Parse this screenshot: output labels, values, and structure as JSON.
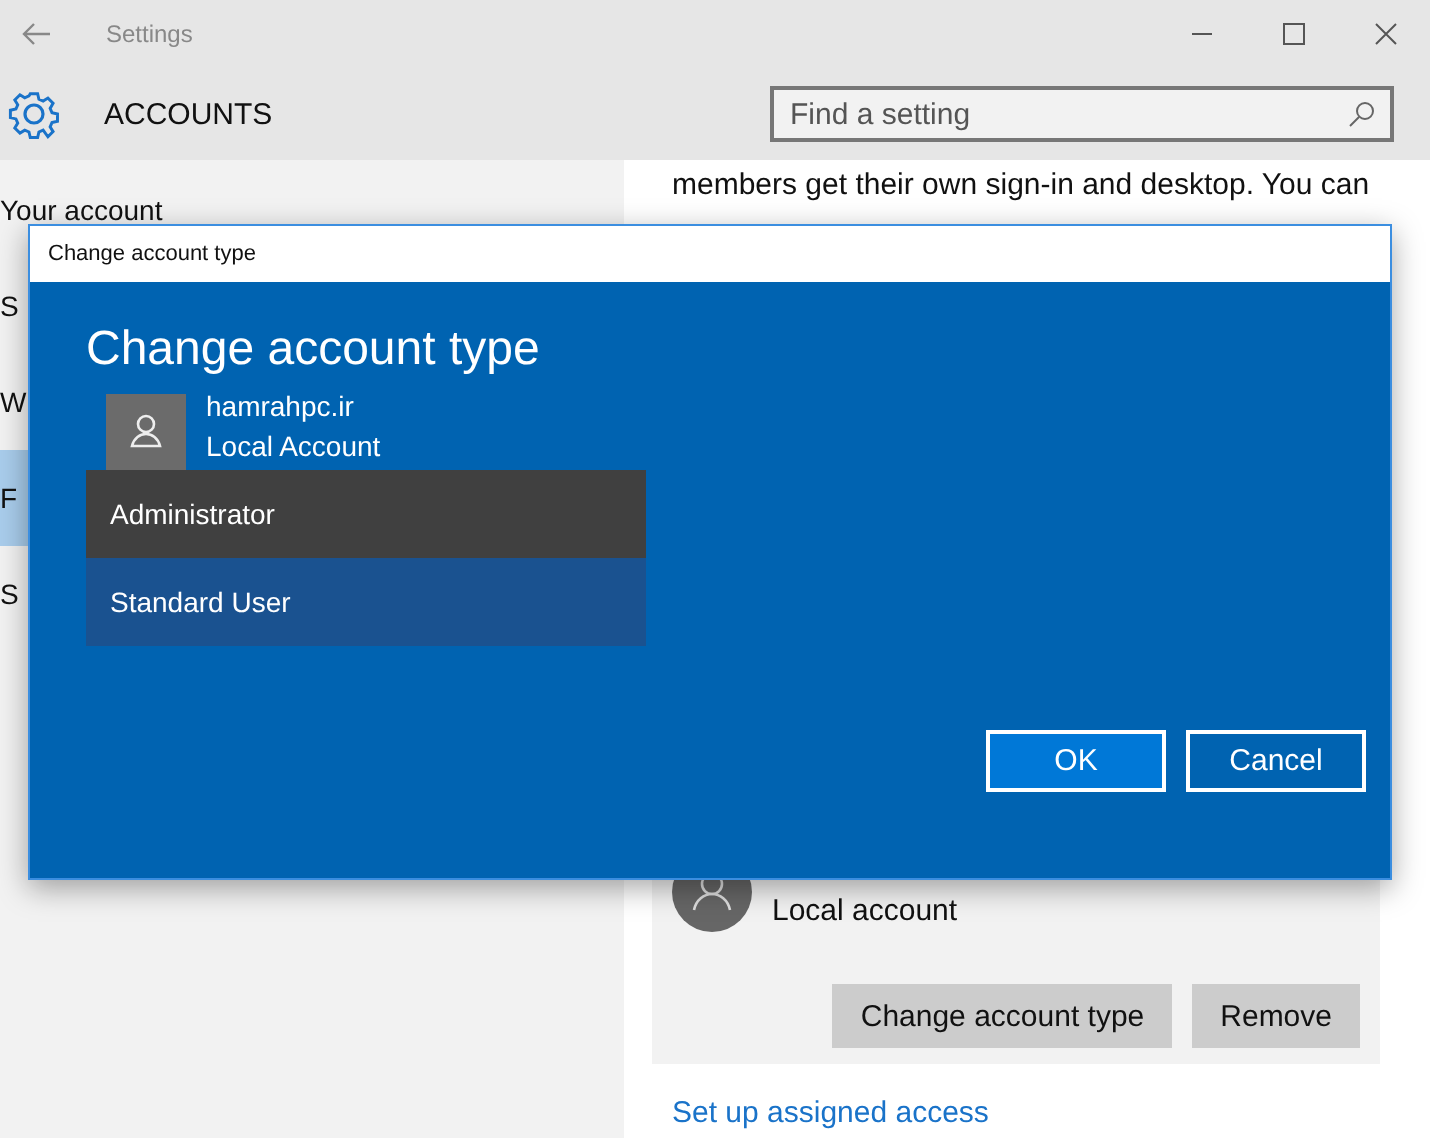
{
  "window": {
    "title": "Settings"
  },
  "header": {
    "title": "ACCOUNTS",
    "search": {
      "placeholder": "Find a setting"
    }
  },
  "sidebar": {
    "items": [
      {
        "label": "Your account",
        "selected": false
      },
      {
        "label": "S",
        "selected": false
      },
      {
        "label": "W",
        "selected": false
      },
      {
        "label": "F",
        "selected": true
      },
      {
        "label": "S",
        "selected": false
      }
    ]
  },
  "content": {
    "intro": "members get their own sign-in and desktop. You can",
    "account": {
      "type": "Local account"
    },
    "buttons": [
      "Change account type",
      "Remove"
    ],
    "link": "Set up assigned access"
  },
  "dialog": {
    "window_title": "Change account type",
    "heading": "Change account type",
    "user": {
      "name": "hamrahpc.ir",
      "type": "Local Account"
    },
    "options": [
      {
        "label": "Administrator",
        "selected": true
      },
      {
        "label": "Standard User",
        "selected": false
      }
    ],
    "buttons": [
      "OK",
      "Cancel"
    ]
  }
}
